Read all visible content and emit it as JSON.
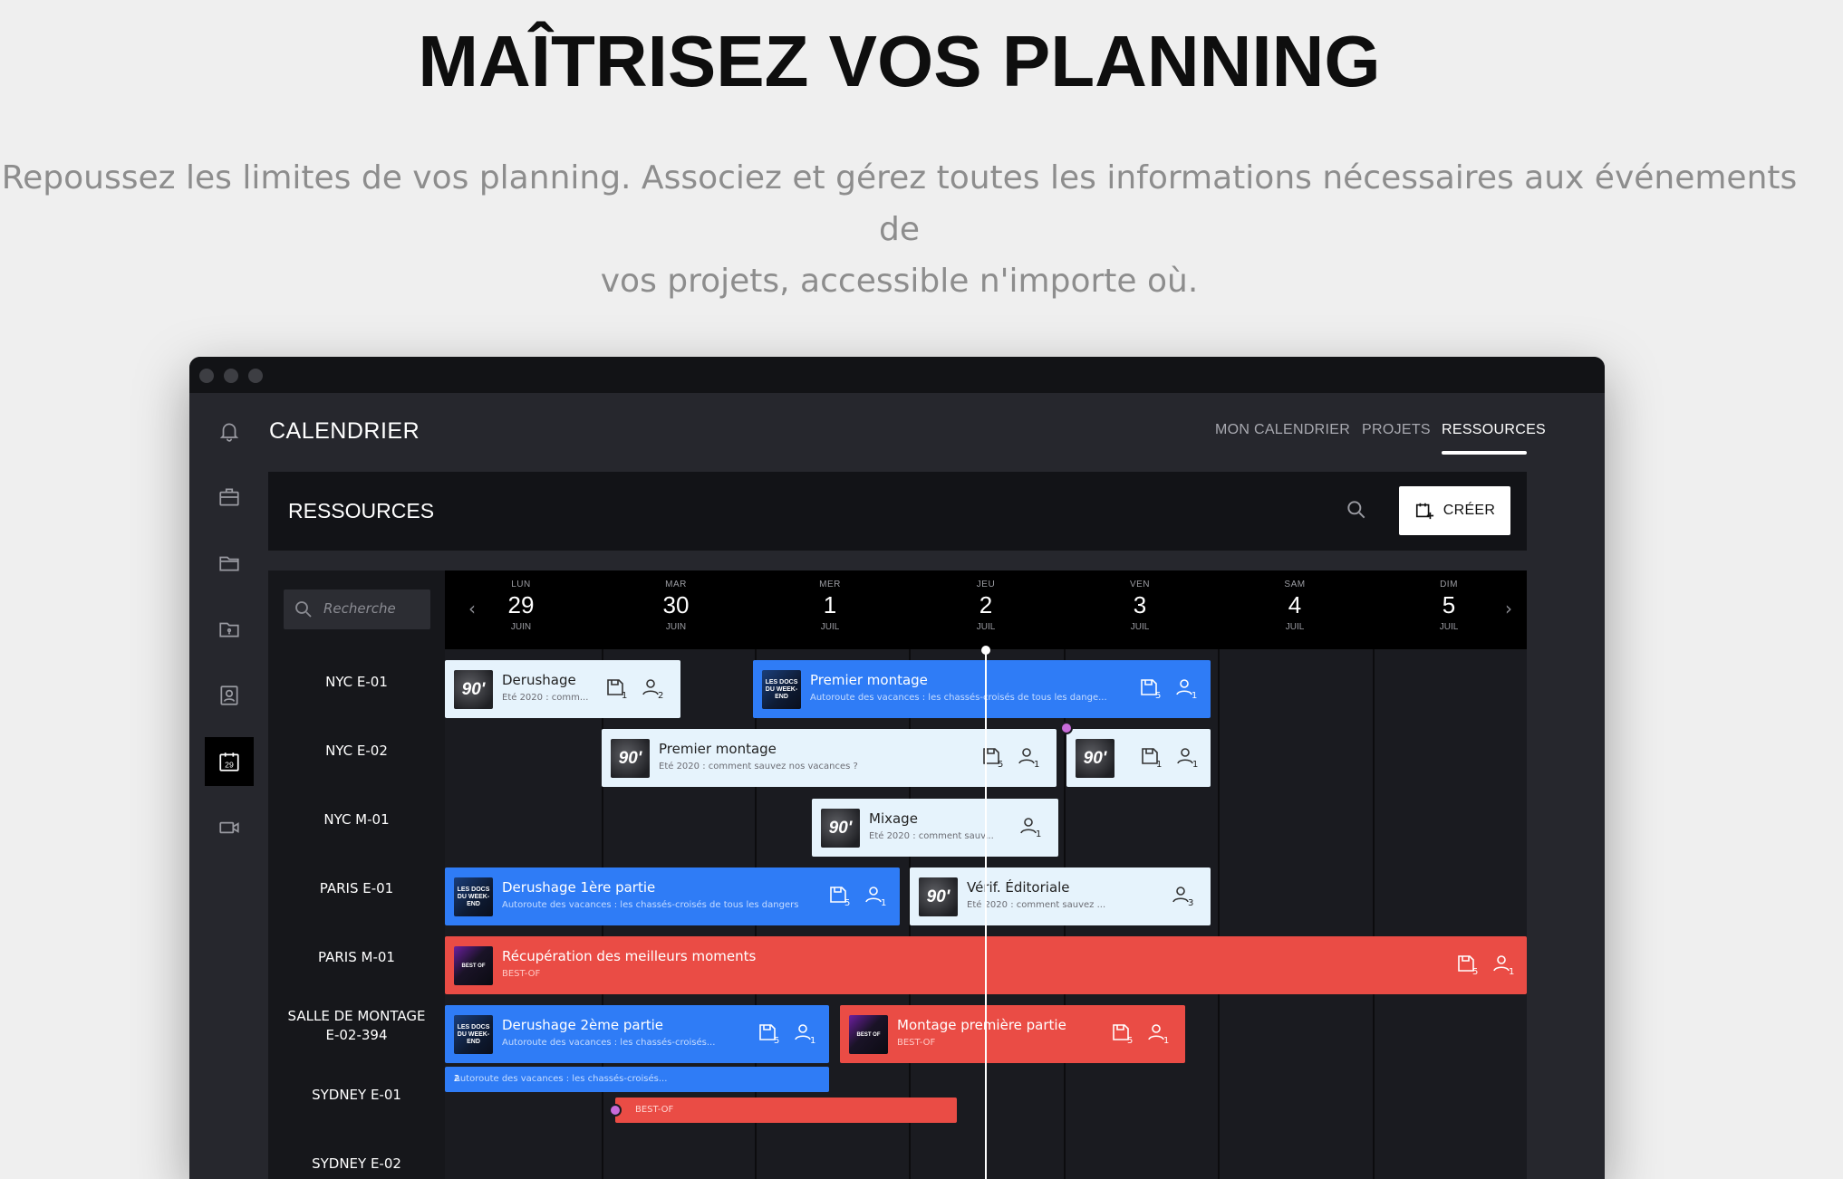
{
  "hero": {
    "title": "MAÎTRISEZ VOS PLANNING",
    "subtitle_line1": "Repoussez les limites de vos planning. Associez et gérez toutes les informations nécessaires aux événements de",
    "subtitle_line2": "vos projets, accessible n'importe où."
  },
  "app": {
    "title": "CALENDRIER",
    "sidebar_icons": [
      "bell-icon",
      "briefcase-icon",
      "folder-icon",
      "folder-badge-icon",
      "contact-book-icon",
      "calendar-icon",
      "video-camera-icon"
    ],
    "calendar_icon_day": "29",
    "nav": {
      "my_calendar": "MON CALENDRIER",
      "projects": "PROJETS",
      "resources": "RESSOURCES"
    }
  },
  "resources": {
    "header_title": "RESSOURCES",
    "create_label": "CRÉER",
    "search_placeholder": "Recherche"
  },
  "days": [
    {
      "name": "LUN",
      "date": "29",
      "month": "JUIN"
    },
    {
      "name": "MAR",
      "date": "30",
      "month": "JUIN"
    },
    {
      "name": "MER",
      "date": "1",
      "month": "JUIL"
    },
    {
      "name": "JEU",
      "date": "2",
      "month": "JUIL"
    },
    {
      "name": "VEN",
      "date": "3",
      "month": "JUIL"
    },
    {
      "name": "SAM",
      "date": "4",
      "month": "JUIL"
    },
    {
      "name": "DIM",
      "date": "5",
      "month": "JUIL"
    }
  ],
  "rows": [
    {
      "label": "NYC E-01"
    },
    {
      "label": "NYC E-02"
    },
    {
      "label": "NYC M-01"
    },
    {
      "label": "PARIS E-01"
    },
    {
      "label": "PARIS M-01"
    },
    {
      "label": "SALLE DE MONTAGE",
      "label2": "E-02-394"
    },
    {
      "label": "SYDNEY E-01"
    },
    {
      "label": "SYDNEY E-02"
    }
  ],
  "events": {
    "e1": {
      "title": "Derushage",
      "subtitle": "Été 2020 : comm...",
      "docs": "1",
      "people": "2",
      "thumb": "90'"
    },
    "e2": {
      "title": "Premier montage",
      "subtitle": "Autoroute des vacances : les chassés-croisés de tous les dange...",
      "docs": "5",
      "people": "1",
      "thumb": "LES DOCS DU WEEK-END"
    },
    "e3": {
      "title": "Premier montage",
      "subtitle": "Été 2020 : comment sauvez nos vacances ?",
      "docs": "5",
      "people": "1",
      "thumb": "90'"
    },
    "e4": {
      "docs": "1",
      "people": "1",
      "thumb": "90'"
    },
    "e5": {
      "title": "Mixage",
      "subtitle": "Été 2020 : comment sauv...",
      "people": "1",
      "thumb": "90'"
    },
    "e6": {
      "title": "Derushage 1ère partie",
      "subtitle": "Autoroute des vacances : les chassés-croisés de tous les dangers",
      "docs": "5",
      "people": "1",
      "thumb": "LES DOCS DU WEEK-END"
    },
    "e7": {
      "title": "Vérif. Éditoriale",
      "subtitle": "Été 2020 : comment sauvez ...",
      "people": "3",
      "thumb": "90'"
    },
    "e8": {
      "title": "Récupération des meilleurs moments",
      "subtitle": "BEST-OF",
      "docs": "5",
      "people": "1",
      "thumb": "BEST OF"
    },
    "e9": {
      "title": "Derushage 2ème partie",
      "subtitle": "Autoroute des vacances : les chassés-croisés...",
      "docs": "5",
      "people": "1",
      "thumb": "LES DOCS DU WEEK-END"
    },
    "e10": {
      "title": "Montage première partie",
      "subtitle": "BEST-OF",
      "docs": "5",
      "people": "1",
      "thumb": "BEST OF"
    },
    "b1": {
      "text": "Autoroute des vacances : les chassés-croisés...",
      "count": "2"
    },
    "b2": {
      "text": "BEST-OF"
    }
  },
  "colors": {
    "accent_blue": "#2f7cf6",
    "accent_red": "#ea4c45",
    "light_event": "#e6f3fc",
    "conflict_dot": "#c86bd9"
  }
}
